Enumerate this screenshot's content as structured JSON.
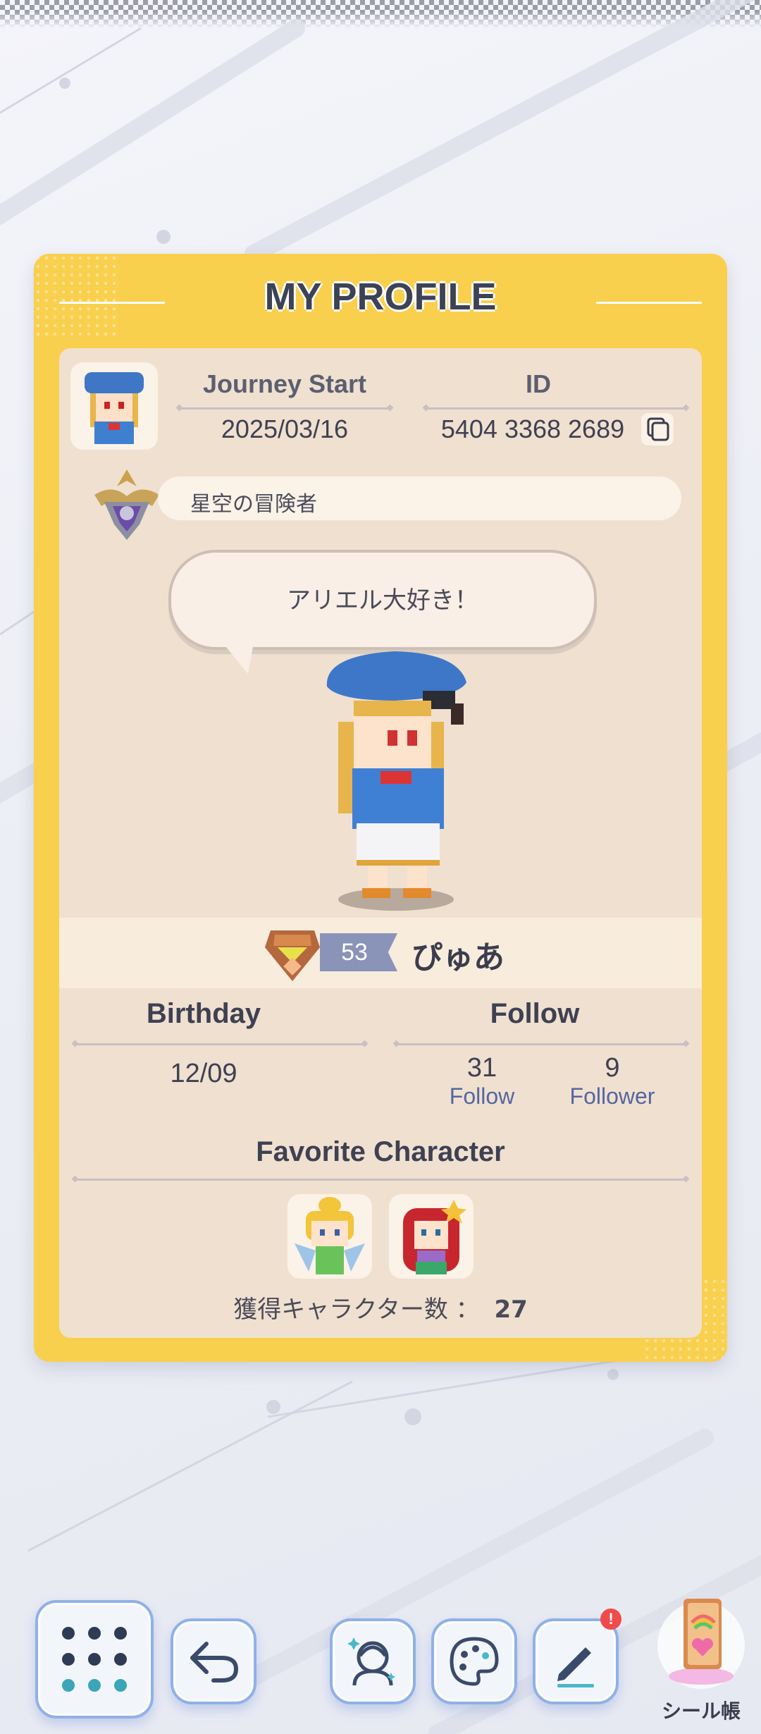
{
  "profile_card": {
    "title": "MY PROFILE",
    "journey_start_label": "Journey Start",
    "journey_start_value": "2025/03/16",
    "id_label": "ID",
    "id_value": "5404 3368 2689",
    "player_title": "星空の冒険者",
    "speech_bubble": "アリエル大好き！",
    "level": "53",
    "player_name": "ぴゅあ",
    "birthday_label": "Birthday",
    "birthday_value": "12/09",
    "follow_section_label": "Follow",
    "follow_count": "31",
    "follow_label": "Follow",
    "follower_count": "9",
    "follower_label": "Follower",
    "favorite_label": "Favorite Character",
    "obtained_label": "獲得キャラクター数 ：",
    "obtained_count": "27"
  },
  "toolbar": {
    "items": [
      {
        "icon": "grid-menu-icon"
      },
      {
        "icon": "back-arrow-icon"
      },
      {
        "icon": "character-avatar-icon"
      },
      {
        "icon": "palette-icon"
      },
      {
        "icon": "pencil-edit-icon",
        "badge": "!"
      },
      {
        "icon": "sticker-book-icon",
        "label": "シール帳"
      }
    ]
  },
  "colors": {
    "card_frame": "#f9cf4e",
    "card_inner": "#f0e0d0",
    "button_border": "#8fb1e6",
    "badge": "#f04a4a",
    "level_tag": "#8a93b8"
  }
}
